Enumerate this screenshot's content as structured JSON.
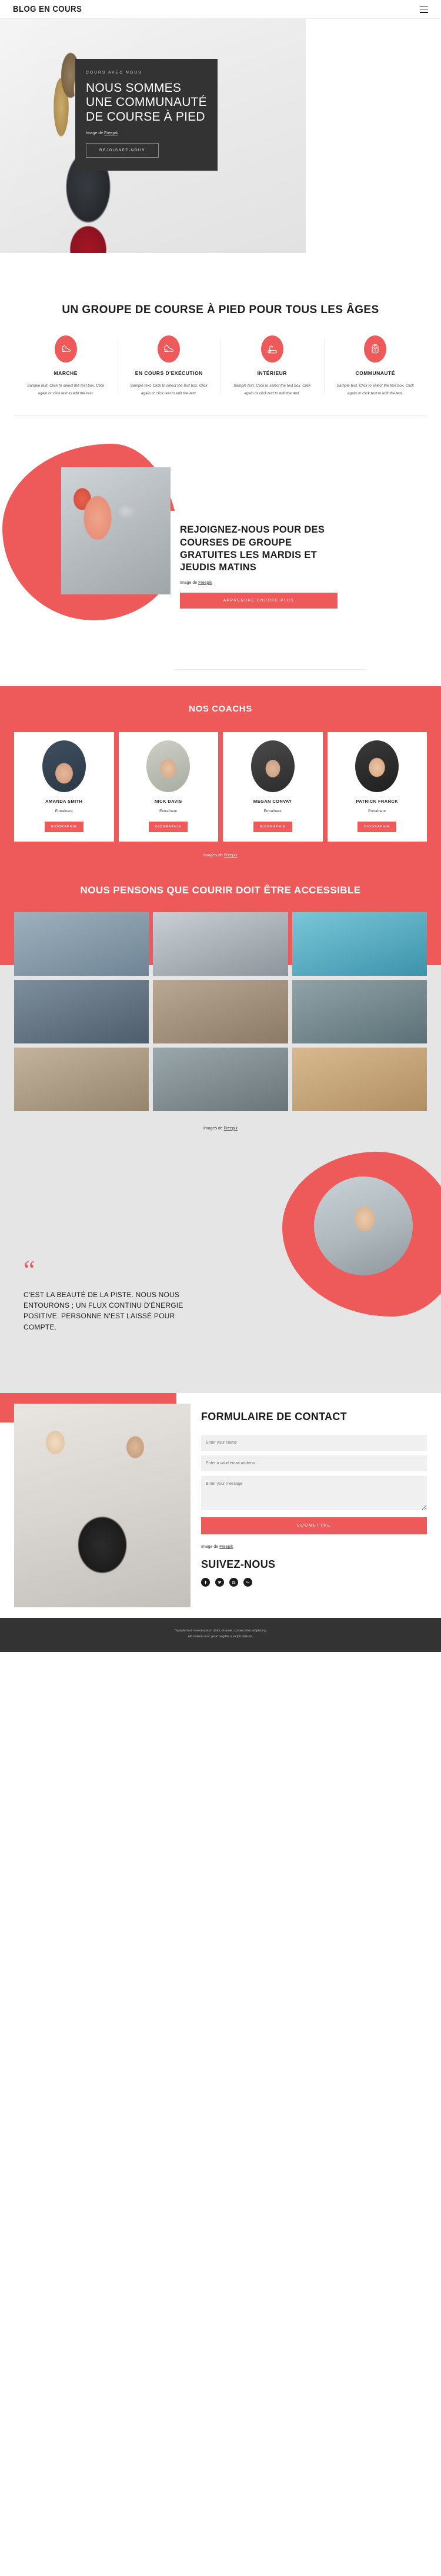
{
  "header": {
    "brand": "BLOG EN COURS",
    "menu_icon": "hamburger-icon"
  },
  "hero": {
    "kicker": "COURS AVEC NOUS",
    "title": "NOUS SOMMES UNE COMMUNAUTÉ DE COURSE À PIED",
    "credit_prefix": "Image de ",
    "credit_link": "Freepik",
    "cta": "REJOIGNEZ-NOUS"
  },
  "features": {
    "title": "UN GROUPE DE COURSE À PIED POUR TOUS LES ÂGES",
    "body": "Sample text. Click to select the text box. Click again or click text to edit the text.",
    "items": [
      {
        "icon": "shoe-walk-icon",
        "name": "MARCHE"
      },
      {
        "icon": "shoe-run-icon",
        "name": "EN COURS D'EXÉCUTION"
      },
      {
        "icon": "treadmill-icon",
        "name": "INTÉRIEUR"
      },
      {
        "icon": "watch-heart-icon",
        "name": "COMMUNAUTÉ"
      }
    ]
  },
  "join": {
    "title": "REJOIGNEZ-NOUS POUR DES COURSES DE GROUPE GRATUITES LES MARDIS ET JEUDIS MATINS",
    "credit_prefix": "Image de ",
    "credit_link": "Freepik",
    "cta": "APPRENDRE ENCORE PLUS"
  },
  "coaches": {
    "title": "NOS COACHS",
    "credit_prefix": "Images de ",
    "credit_link": "Freepik",
    "items": [
      {
        "name": "AMANDA SMITH",
        "role": "Entraîneur",
        "button": "BIOGRAPHIE"
      },
      {
        "name": "NICK DAVIS",
        "role": "Entraîneur",
        "button": "BIOGRAPHIE"
      },
      {
        "name": "MEGAN CONVAY",
        "role": "Entraîneur",
        "button": "BIOGRAPHIE"
      },
      {
        "name": "PATRICK FRANCK",
        "role": "Entraîneur",
        "button": "BIOGRAPHIE"
      }
    ]
  },
  "gallery": {
    "title": "NOUS PENSONS QUE COURIR DOIT ÊTRE ACCESSIBLE",
    "credit_prefix": "Images de ",
    "credit_link": "Freepik"
  },
  "quote": {
    "mark": "“",
    "text": "C'EST LA BEAUTÉ DE LA PISTE. NOUS NOUS ENTOURONS ; UN FLUX CONTINU D'ÉNERGIE POSITIVE. PERSONNE N'EST LAISSÉ POUR COMPTE."
  },
  "contact": {
    "title": "FORMULAIRE DE CONTACT",
    "name_placeholder": "Enter your Name",
    "email_placeholder": "Enter a valid email address",
    "message_placeholder": "Enter your message",
    "submit": "SOUMETTRE",
    "credit_prefix": "Image de ",
    "credit_link": "Freepik",
    "follow_title": "SUIVEZ-NOUS",
    "socials": [
      "facebook-icon",
      "twitter-icon",
      "instagram-icon",
      "google-plus-icon"
    ]
  },
  "footer": {
    "line1": "Sample text. Lorem ipsum dolor sit amet, consectetur adipiscing",
    "line2": "elit nullam nunc justo sagittis suscipit ultrices."
  },
  "colors": {
    "accent": "#ee5a5a",
    "dark": "#333333",
    "ink": "#1c1c1c",
    "muted": "#e5e5e5"
  }
}
